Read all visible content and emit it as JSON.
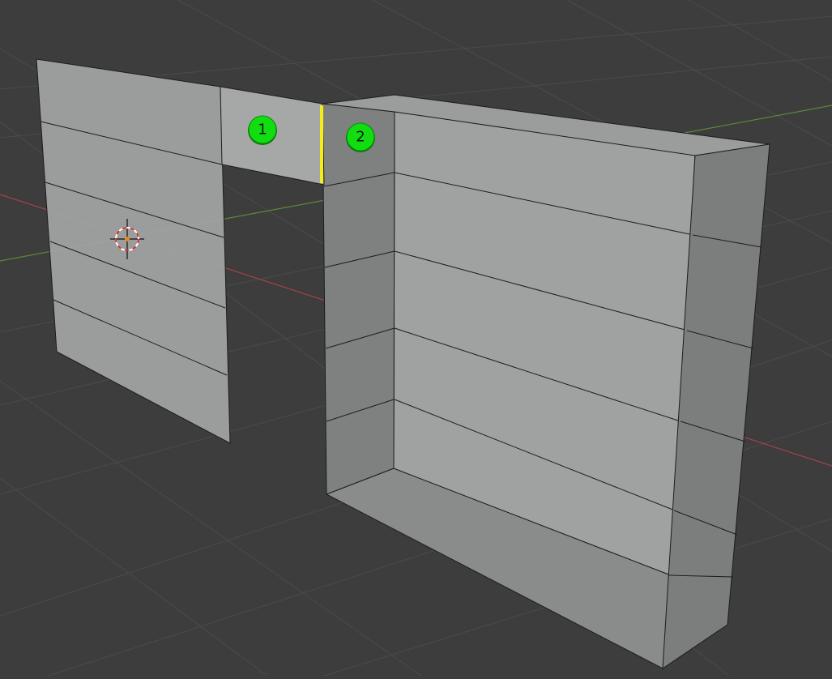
{
  "viewport": {
    "background": "#3d3d3d",
    "grid_color": "#4a4a4a",
    "x_axis_color": "#a8404a",
    "y_axis_color": "#5d8a3a",
    "face_color_light": "#a3a5a5",
    "face_color_dark": "#7f8181",
    "edge_color": "#1c1c1c",
    "selected_edge_color": "#f2ee1a"
  },
  "badges": [
    {
      "label": "1",
      "color": "#11dd11"
    },
    {
      "label": "2",
      "color": "#11dd11"
    }
  ],
  "icons": {
    "cursor": "3d-cursor-icon"
  }
}
